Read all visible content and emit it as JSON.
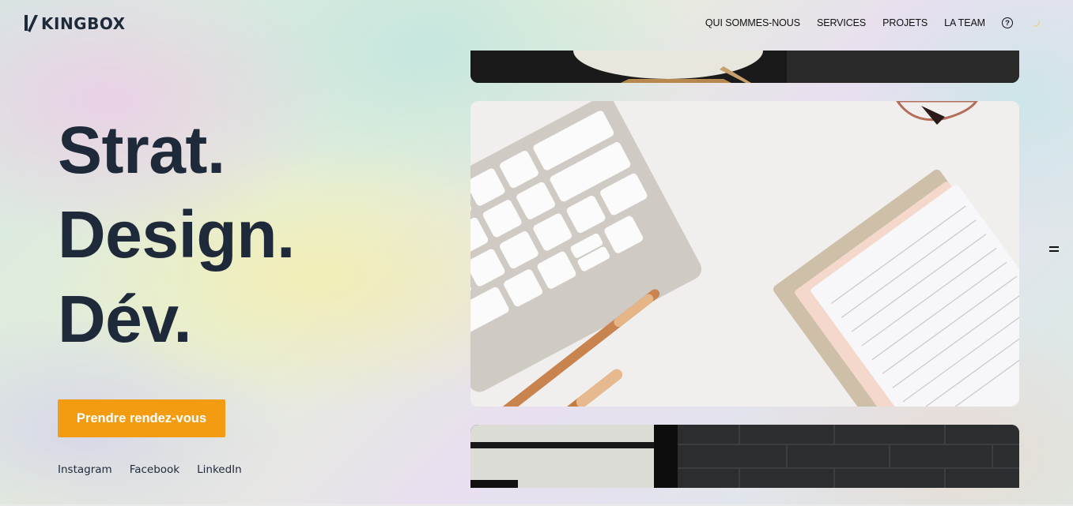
{
  "header": {
    "logo_text": "KINGBOX",
    "nav": [
      {
        "label": "QUI SOMMES-NOUS"
      },
      {
        "label": "SERVICES"
      },
      {
        "label": "PROJETS"
      },
      {
        "label": "LA TEAM"
      }
    ],
    "icons": {
      "help": "help-circle-icon",
      "theme": "moon-icon"
    },
    "help_glyph": "?"
  },
  "hero": {
    "lines": [
      "Strat.",
      "Design.",
      "Dév."
    ],
    "cta_label": "Prendre rendez-vous",
    "socials": [
      "Instagram",
      "Facebook",
      "LinkedIn"
    ]
  },
  "colors": {
    "accent": "#f39c12",
    "heading": "#1e2a3a",
    "moon": "#f5c518"
  },
  "menu_toggle_icon": "menu-icon"
}
